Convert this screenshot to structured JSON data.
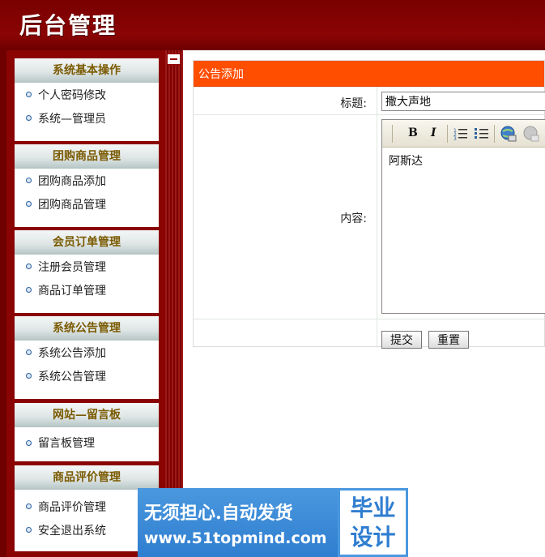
{
  "app": {
    "title": "后台管理"
  },
  "sidebar": {
    "groups": [
      {
        "title": "系统基本操作",
        "items": [
          "个人密码修改",
          "系统—管理员"
        ]
      },
      {
        "title": "团购商品管理",
        "items": [
          "团购商品添加",
          "团购商品管理"
        ]
      },
      {
        "title": "会员订单管理",
        "items": [
          "注册会员管理",
          "商品订单管理"
        ]
      },
      {
        "title": "系统公告管理",
        "items": [
          "系统公告添加",
          "系统公告管理"
        ]
      },
      {
        "title": "网站—留言板",
        "items": [
          "留言板管理"
        ]
      },
      {
        "title": "商品评价管理",
        "items": [
          "商品评价管理",
          "安全退出系统"
        ]
      }
    ]
  },
  "form": {
    "panel_title": "公告添加",
    "title_label": "标题:",
    "title_value": "撒大声地",
    "content_label": "内容:",
    "content_value": "阿斯达",
    "submit_label": "提交",
    "reset_label": "重置"
  },
  "editor_toolbar": {
    "bold": "B",
    "italic": "I"
  },
  "watermark": {
    "line1": "无须担心.自动发货",
    "line2": "www.51topmind.com",
    "badge_line1": "毕业",
    "badge_line2": "设计"
  },
  "colors": {
    "header": "#8a0404",
    "panel_head": "#ff4e00",
    "watermark": "#2f7ed0"
  }
}
